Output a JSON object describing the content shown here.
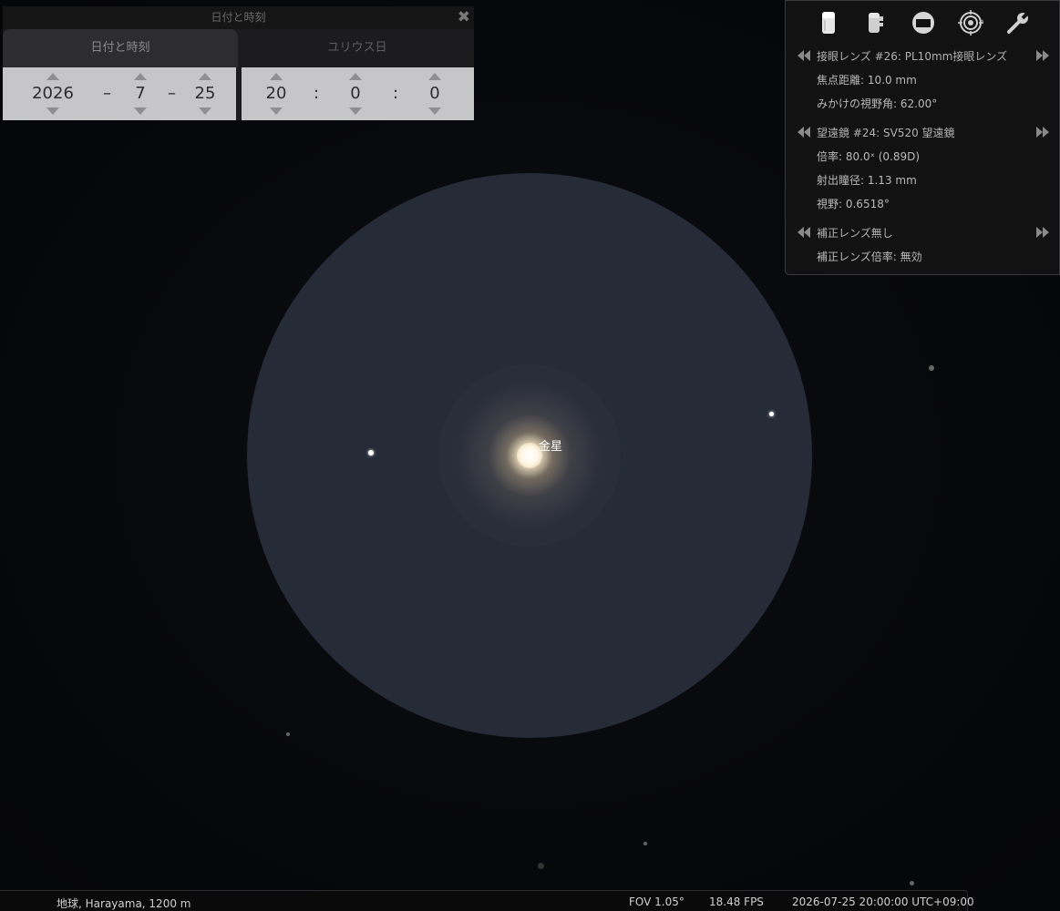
{
  "sky": {
    "object_label": "金星"
  },
  "datetime_dialog": {
    "title": "日付と時刻",
    "close_glyph": "✖",
    "tabs": {
      "date_time": "日付と時刻",
      "julian_day": "ユリウス日"
    },
    "date": {
      "year": "2026",
      "month": "7",
      "day": "25",
      "separator": "–"
    },
    "time": {
      "hour": "20",
      "minute": "0",
      "second": "0",
      "separator": ":"
    }
  },
  "oculars": {
    "toolbar_icons": [
      "eyepiece-icon",
      "telescope-icon",
      "sensor-frame-icon",
      "reticle-icon",
      "wrench-icon"
    ],
    "eyepiece": {
      "name": "接眼レンズ #26: PL10mm接眼レンズ",
      "focal_length": "焦点距離: 10.0 mm",
      "apparent_fov": "みかけの視野角: 62.00°"
    },
    "telescope": {
      "name": "望遠鏡 #24: SV520 望遠鏡",
      "magnification": "倍率: 80.0ˣ (0.89D)",
      "exit_pupil": "射出瞳径: 1.13 mm",
      "fov": "視野: 0.6518°"
    },
    "lens": {
      "name": "補正レンズ無し",
      "multiplier": "補正レンズ倍率: 無効"
    }
  },
  "status_bar": {
    "location": "地球, Harayama, 1200 m",
    "fov": "FOV 1.05°",
    "fps": "18.48 FPS",
    "datetime": "2026-07-25 20:00:00 UTC+09:00"
  }
}
